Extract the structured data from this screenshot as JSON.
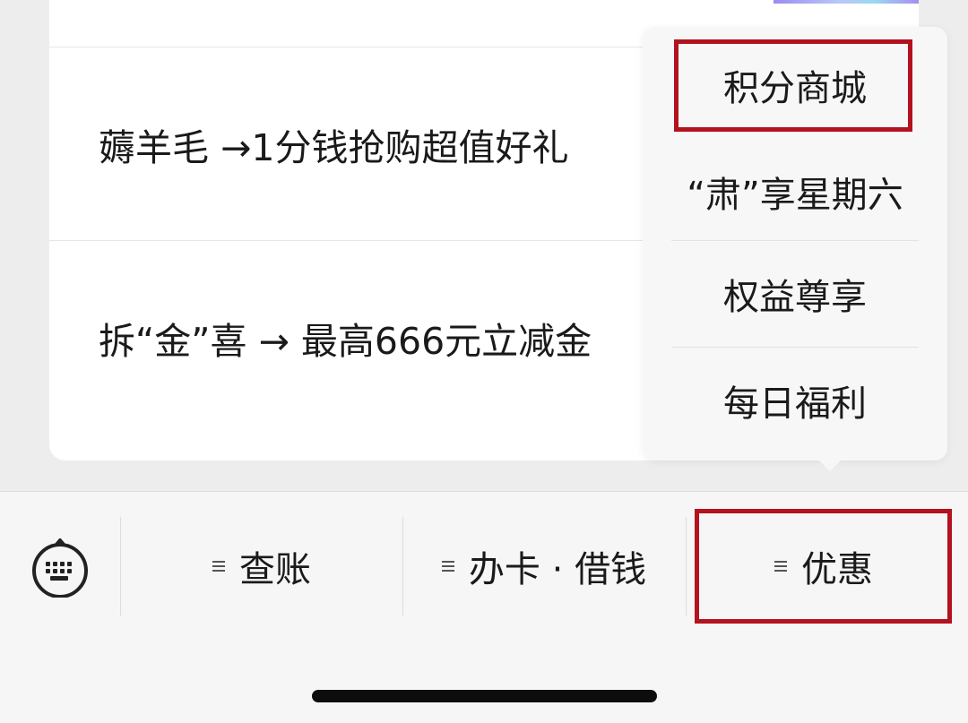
{
  "content": {
    "rows": [
      {
        "label": "薅羊毛 →1分钱抢购超值好礼"
      },
      {
        "label": "拆“金”喜 → 最高666元立减金"
      }
    ]
  },
  "popup_menu": {
    "items": [
      {
        "label": "积分商城",
        "highlighted": true
      },
      {
        "label": "“肃”享星期六"
      },
      {
        "label": "权益尊享"
      },
      {
        "label": "每日福利"
      }
    ]
  },
  "bottom_menu": {
    "keyboard_icon": "keyboard-icon",
    "tabs": [
      {
        "label": "查账",
        "icon": "menu-icon"
      },
      {
        "label": "办卡 · 借钱",
        "icon": "menu-icon"
      },
      {
        "label": "优惠",
        "icon": "menu-icon",
        "highlighted": true
      }
    ]
  },
  "colors": {
    "highlight": "#b3121e",
    "background": "#ededed",
    "card": "#ffffff",
    "popup": "#f7f7f7"
  }
}
